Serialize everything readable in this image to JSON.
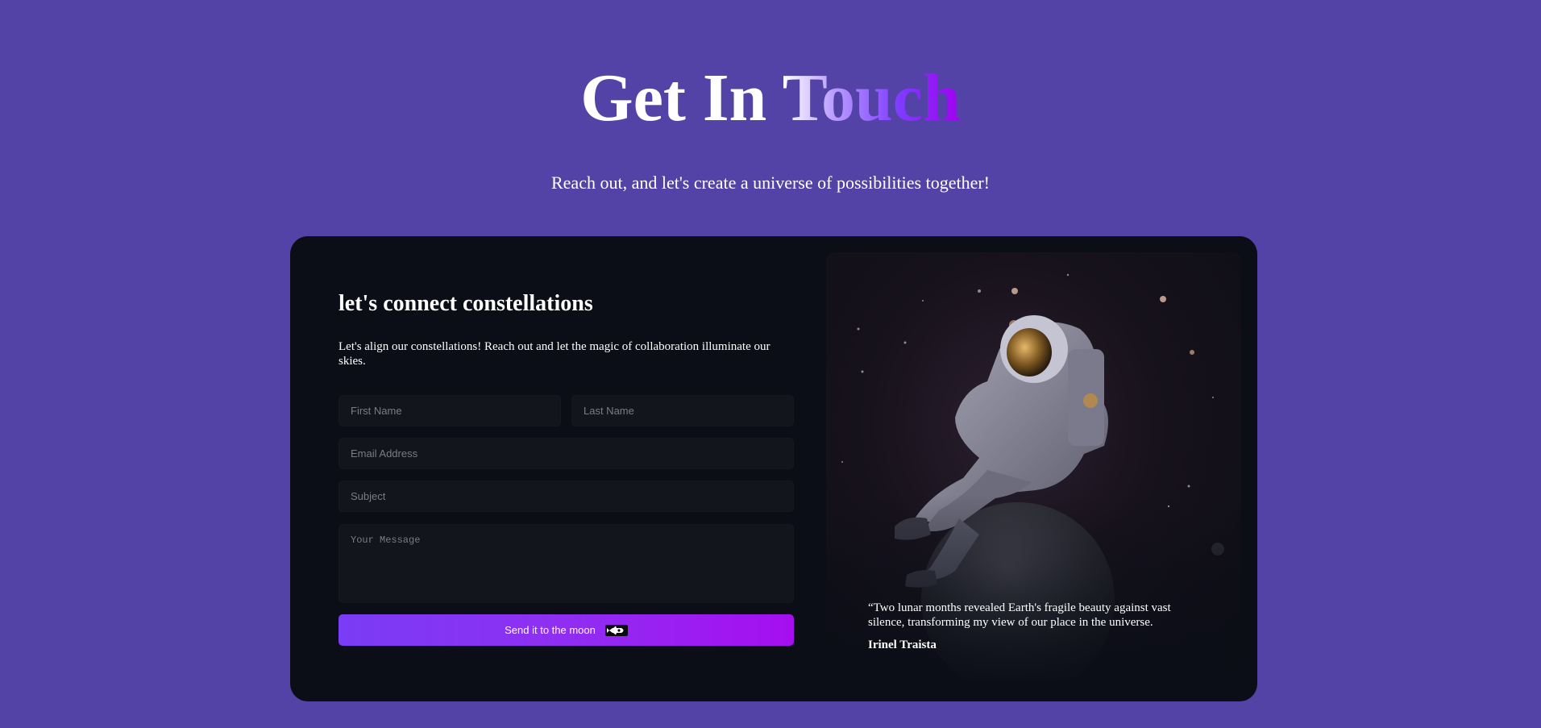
{
  "hero": {
    "title_plain": "Get In",
    "title_accent": "Touch",
    "subtitle": "Reach out, and let's create a universe of possibilities together!"
  },
  "form": {
    "heading": "let's connect constellations",
    "intro": "Let's align our constellations! Reach out and let the magic of collaboration illuminate our skies.",
    "first_name_placeholder": "First Name",
    "last_name_placeholder": "Last Name",
    "email_placeholder": "Email Address",
    "subject_placeholder": "Subject",
    "message_placeholder": "Your Message",
    "submit_label": "Send it to the moon",
    "submit_icon": "rocket-icon"
  },
  "testimonial": {
    "image": "astronaut-sitting-on-planet-illustration",
    "quote": "“Two lunar months revealed Earth's fragile beauty against vast silence, transforming my view of our place in the universe.",
    "author": "Irinel Traista"
  },
  "colors": {
    "background": "#5443a6",
    "card": "#0b0e17",
    "field": "#12151b",
    "accent_start": "#7a3cf5",
    "accent_end": "#a60ef0"
  }
}
